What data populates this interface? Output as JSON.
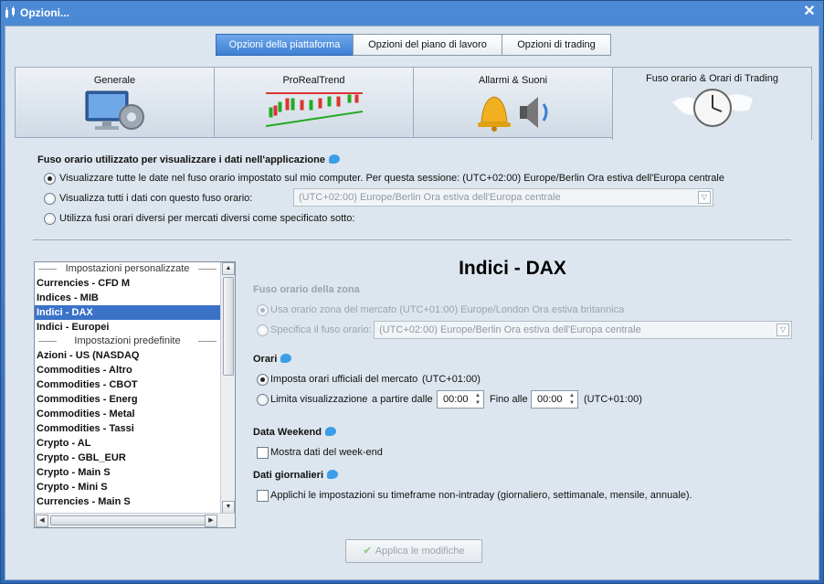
{
  "window": {
    "title": "Opzioni...",
    "close_glyph": "✕"
  },
  "top_tabs": [
    "Opzioni della piattaforma",
    "Opzioni del piano di lavoro",
    "Opzioni di trading"
  ],
  "big_tabs": [
    "Generale",
    "ProRealTrend",
    "Allarmi & Suoni",
    "Fuso orario & Orari di Trading"
  ],
  "timezone_section": {
    "heading": "Fuso orario utilizzato per visualizzare i dati nell'applicazione",
    "opt1": "Visualizzare tutte le date nel fuso orario impostato sul mio computer. Per questa sessione: (UTC+02:00) Europe/Berlin Ora estiva dell'Europa centrale",
    "opt2": "Visualizza tutti i dati con questo fuso orario:",
    "opt2_combo": "(UTC+02:00) Europe/Berlin Ora estiva dell'Europa centrale",
    "opt3": "Utilizza fusi orari diversi per mercati diversi come specificato sotto:"
  },
  "list": {
    "group_custom": "Impostazioni personalizzate",
    "custom_items": [
      "Currencies - CFD M",
      "Indices - MIB",
      "Indici - DAX",
      "Indici - Europei"
    ],
    "group_predef": "Impostazioni predefinite",
    "predef_items": [
      "Azioni - US (NASDAQ",
      "Commodities - Altro",
      "Commodities - CBOT",
      "Commodities - Energ",
      "Commodities - Metal",
      "Commodities - Tassi",
      "Crypto - AL",
      "Crypto - GBL_EUR",
      "Crypto - Main S",
      "Crypto - Mini S",
      "Currencies - Main S"
    ],
    "selected": "Indici - DAX"
  },
  "detail": {
    "title": "Indici - DAX",
    "zone_heading": "Fuso orario della zona",
    "zone_opt1": "Usa orario zona del mercato (UTC+01:00) Europe/London Ora estiva britannica",
    "zone_opt2": "Specifica il fuso orario:",
    "zone_combo": "(UTC+02:00) Europe/Berlin Ora estiva dell'Europa centrale",
    "hours_heading": "Orari",
    "hours_opt1": "Imposta orari ufficiali del mercato",
    "hours_opt1_tz": "(UTC+01:00)",
    "hours_opt2": "Limita visualizzazione",
    "from_label": "a partire dalle",
    "from_value": "00:00",
    "to_label": "Fino alle",
    "to_value": "00:00",
    "to_tz": "(UTC+01:00)",
    "weekend_heading": "Data Weekend",
    "weekend_check": "Mostra dati del week-end",
    "daily_heading": "Dati giornalieri",
    "daily_check": "Applichi le impostazioni su timeframe non-intraday (giornaliero, settimanale, mensile, annuale)."
  },
  "apply_button": "Applica le modifiche"
}
